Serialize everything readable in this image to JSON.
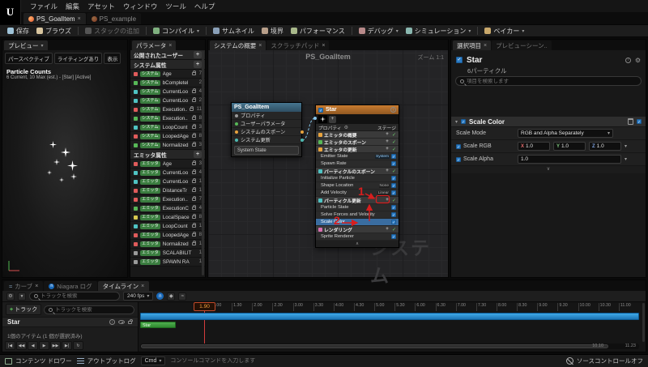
{
  "icons": {
    "dropdown": "▾",
    "close": "×",
    "plus": "+",
    "info": "i",
    "gear": "⚙",
    "collapse": "∧",
    "expand": "∨",
    "filter": "▼",
    "n_badge": "n",
    "curve": "≈"
  },
  "menubar": {
    "logo": "U",
    "items": [
      "ファイル",
      "編集",
      "アセット",
      "ウィンドウ",
      "ツール",
      "ヘルプ"
    ]
  },
  "asset_tabs": {
    "active": "PS_GoalItem",
    "inactive": "PS_example"
  },
  "toolbar": {
    "save": "保存",
    "browse": "ブラウズ",
    "add_stack": "スタックの追加",
    "compile": "コンパイル",
    "thumbnail": "サムネイル",
    "bounds": "境界",
    "performance": "パフォーマンス",
    "debug": "デバッグ",
    "simulation": "シミュレーション",
    "baker": "ベイカー"
  },
  "preview": {
    "tab": "プレビュー",
    "perspective": "パースペクティブ",
    "lit": "ライティングあり",
    "show": "表示",
    "stats_title": "Particle Counts",
    "stats_line": "6 Current, 10 Max (est.) - [Star] [Active]"
  },
  "parameters": {
    "tab": "パラメータ",
    "section_user": "公開されたユーザー",
    "section_system": "システム属性",
    "section_emitter": "エミッタ属性",
    "system_items": [
      {
        "tag": "システム",
        "name": "Age",
        "color": "#e05b5b",
        "count": "7",
        "locked": true
      },
      {
        "tag": "システム",
        "name": "bCompletel",
        "color": "#57b857",
        "count": "2",
        "locked": false
      },
      {
        "tag": "システム",
        "name": "CurrentLoo",
        "color": "#4fc3c3",
        "count": "4",
        "locked": true
      },
      {
        "tag": "システム",
        "name": "CurrentLoo",
        "color": "#4fc3c3",
        "count": "2",
        "locked": true
      },
      {
        "tag": "システム",
        "name": "Execution..",
        "color": "#e05b5b",
        "count": "11",
        "locked": true
      },
      {
        "tag": "システム",
        "name": "Execution..",
        "color": "#57b857",
        "count": "8",
        "locked": true
      },
      {
        "tag": "システム",
        "name": "LoopCount",
        "color": "#4fc3c3",
        "count": "3",
        "locked": true
      },
      {
        "tag": "システム",
        "name": "LoopedAge",
        "color": "#e05b5b",
        "count": "8",
        "locked": true
      },
      {
        "tag": "システム",
        "name": "Normalized",
        "color": "#57b857",
        "count": "3",
        "locked": true
      }
    ],
    "emitter_items": [
      {
        "tag": "エミッタ",
        "name": "Age",
        "color": "#e05b5b",
        "count": "3",
        "locked": true
      },
      {
        "tag": "エミッタ",
        "name": "CurrentLoo",
        "color": "#4fc3c3",
        "count": "4",
        "locked": true
      },
      {
        "tag": "エミッタ",
        "name": "CurrentLoo",
        "color": "#4fc3c3",
        "count": "1",
        "locked": true
      },
      {
        "tag": "エミッタ",
        "name": "DistanceTr",
        "color": "#e05b5b",
        "count": "1",
        "locked": true
      },
      {
        "tag": "エミッタ",
        "name": "Execution..",
        "color": "#e05b5b",
        "count": "7",
        "locked": true
      },
      {
        "tag": "エミッタ",
        "name": "ExecutionC",
        "color": "#57b857",
        "count": "4",
        "locked": true
      },
      {
        "tag": "エミッタ",
        "name": "LocalSpace",
        "color": "#d8c84f",
        "count": "8",
        "locked": true
      },
      {
        "tag": "エミッタ",
        "name": "LoopCount",
        "color": "#4fc3c3",
        "count": "1",
        "locked": true
      },
      {
        "tag": "エミッタ",
        "name": "LoopedAge",
        "color": "#e05b5b",
        "count": "8",
        "locked": true
      },
      {
        "tag": "エミッタ",
        "name": "Normalized",
        "color": "#e05b5b",
        "count": "1",
        "locked": true
      },
      {
        "tag": "エミッタ",
        "name": "SCALABILIT",
        "color": "#9a9a9a",
        "count": "1",
        "locked": false
      },
      {
        "tag": "エミッタ",
        "name": "SPAWN RA",
        "color": "#9a9a9a",
        "count": "1",
        "locked": false
      }
    ]
  },
  "overview": {
    "tab1": "システムの概要",
    "tab2": "スクラッチパッド",
    "title": "PS_GoalItem",
    "zoom": "ズーム 1:1",
    "watermark": "システム",
    "system_node": {
      "title": "PS_GoalItem",
      "rows": [
        {
          "label": "プロパティ",
          "color": "#9a9a9a"
        },
        {
          "label": "ユーザーパラメータ",
          "color": "#57b857"
        },
        {
          "label": "システムのスポーン",
          "color": "#e8a33d"
        },
        {
          "label": "システム更新",
          "color": "#4db8b0"
        }
      ],
      "state": "System State"
    },
    "star_node": {
      "title": "Star",
      "props_label": "プロパティ",
      "stage_label": "ステージ",
      "items": [
        {
          "t": "sec",
          "label": "エミッタの概要",
          "color": "#e8a33d"
        },
        {
          "t": "sec",
          "label": "エミッタのスポーン",
          "color": "#57b857"
        },
        {
          "t": "sec",
          "label": "エミッタの更新",
          "color": "#e8a33d"
        },
        {
          "t": "mod",
          "label": "Emitter State",
          "badge": "System",
          "badge_style": "cyan"
        },
        {
          "t": "mod",
          "label": "Spawn Rate"
        },
        {
          "t": "sec",
          "label": "パーティクルのスポーン",
          "color": "#4fc3c3"
        },
        {
          "t": "mod",
          "label": "Initialize Particle"
        },
        {
          "t": "mod",
          "label": "Shape Location",
          "badge": "None",
          "badge_style": "dim"
        },
        {
          "t": "mod",
          "label": "Add Velocity",
          "badge": "Linear",
          "badge_style": "dim"
        },
        {
          "t": "sec",
          "label": "パーティクル更新",
          "color": "#4fc3c3",
          "annotated": true
        },
        {
          "t": "mod",
          "label": "Particle State"
        },
        {
          "t": "mod",
          "label": "Solve Forces and Velocity"
        },
        {
          "t": "mod",
          "label": "Scale Color",
          "selected": true
        },
        {
          "t": "sec",
          "label": "レンダリング",
          "color": "#d86fb0"
        },
        {
          "t": "mod",
          "label": "Sprite Renderer"
        }
      ]
    },
    "annotations": {
      "step1": "1",
      "step2": "2"
    }
  },
  "selection": {
    "tab1": "選択項目",
    "tab2": "プレビューシーン..",
    "title": "Star",
    "subtitle": "6パーティクル",
    "search_placeholder": "項目を検索します",
    "group_title": "Scale Color",
    "scale_mode_label": "Scale Mode",
    "scale_mode_value": "RGB and Alpha Separately",
    "scale_rgb_label": "Scale RGB",
    "axis_x": "X",
    "axis_y": "Y",
    "axis_z": "Z",
    "x_value": "1.0",
    "y_value": "1.0",
    "z_value": "1.0",
    "scale_alpha_label": "Scale Alpha",
    "alpha_value": "1.0"
  },
  "timeline": {
    "tab1": "カーブ",
    "tab2": "Niagara ログ",
    "tab3": "タイムライン",
    "track_search_placeholder": "トラックを検索",
    "fps": "240 fps",
    "add_track_label": "トラック",
    "track_name": "Star",
    "current_time": "1.90",
    "ticks": [
      "1.00",
      "1.30",
      "2.00",
      "2.30",
      "3.00",
      "3.30",
      "4.00",
      "4.30",
      "5.00",
      "5.30",
      "6.00",
      "6.30",
      "7.00",
      "7.30",
      "8.00",
      "8.30",
      "9.00",
      "9.30",
      "10.00",
      "10.30",
      "11.00"
    ],
    "transport": [
      "|◀",
      "◀◀",
      "◀",
      "▶",
      "▶▶",
      "▶|",
      "↻"
    ],
    "footer": "1個のアイテム (1 個が選択済み)",
    "range_start": "10.10",
    "range_end": "11.23"
  },
  "statusbar": {
    "content_drawer": "コンテンツ ドロワー",
    "output_log": "アウトプットログ",
    "cmd_label": "Cmd",
    "cmd_placeholder": "コンソールコマンドを入力します",
    "source_control": "ソースコントロールオフ"
  }
}
